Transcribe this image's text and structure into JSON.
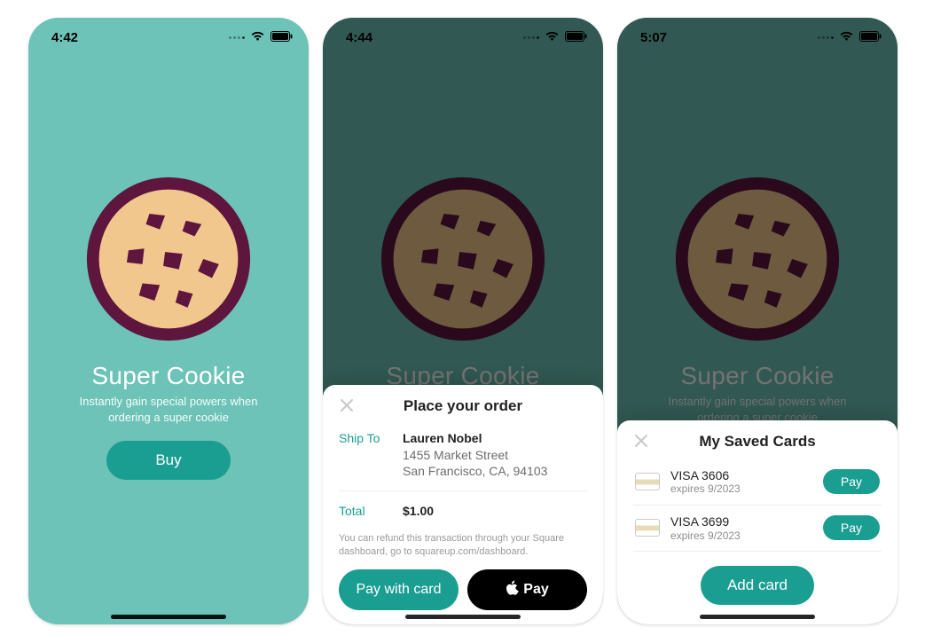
{
  "colors": {
    "teal_bg": "#6dc3b7",
    "teal_dark": "#1a9e92",
    "cookie_crust": "#5e163e",
    "cookie_fill": "#f2c78d"
  },
  "screens": {
    "primary": {
      "status_time": "4:42",
      "product_title": "Super Cookie",
      "product_subtitle": "Instantly gain special powers when ordering a super cookie",
      "buy_label": "Buy"
    },
    "order": {
      "status_time": "4:44",
      "sheet_title": "Place your order",
      "rows": {
        "ship_to_label": "Ship To",
        "ship_to_name": "Lauren Nobel",
        "ship_to_address": "1455 Market Street\nSan Francisco, CA, 94103",
        "total_label": "Total",
        "total_value": "$1.00"
      },
      "refund_note": "You can refund this transaction through your Square dashboard, go to squareup.com/dashboard.",
      "pay_with_card_label": "Pay with card",
      "apple_pay_brand": "Pay"
    },
    "cards": {
      "status_time": "5:07",
      "sheet_title": "My Saved Cards",
      "items": [
        {
          "name": "VISA 3606",
          "expires": "expires 9/2023",
          "pay_label": "Pay"
        },
        {
          "name": "VISA 3699",
          "expires": "expires 9/2023",
          "pay_label": "Pay"
        }
      ],
      "add_card_label": "Add card"
    }
  },
  "icons": {
    "close": "close-icon",
    "wifi": "wifi-icon",
    "battery": "battery-icon",
    "cellular": "cellular-dots-icon",
    "apple": "apple-logo-icon",
    "card": "card-icon",
    "cookie": "cookie-icon"
  }
}
